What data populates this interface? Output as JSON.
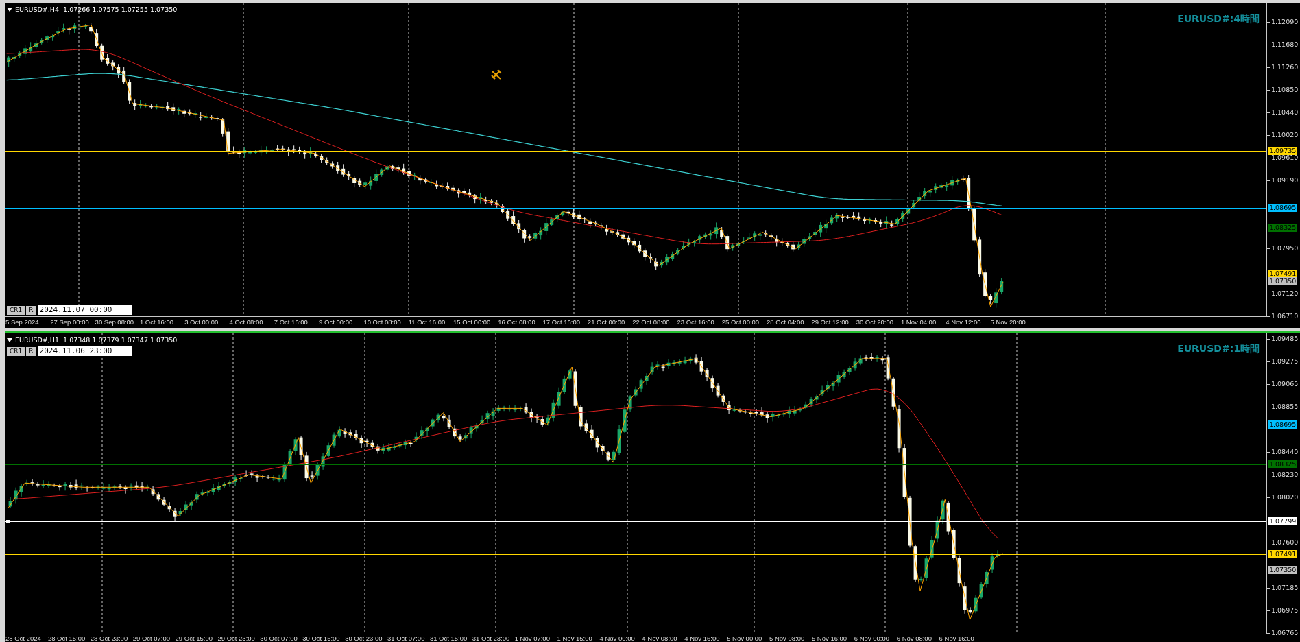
{
  "panels": [
    {
      "active": false,
      "header": "EURUSD#,H4  1.07266 1.07575 1.07255 1.07350",
      "title": "EURUSD#:4時間",
      "toolbar": {
        "buttons": [
          "CR1",
          "R"
        ],
        "date": "2024.11.07 00:00"
      },
      "price_ticks": [
        "1.12090",
        "1.11680",
        "1.11260",
        "1.10850",
        "1.10440",
        "1.10020",
        "1.09610",
        "1.09190",
        "1.07950",
        "1.07120",
        "1.06710"
      ],
      "price_levels": [
        {
          "price": "1.09735",
          "kind": "line",
          "color": "#ffd700"
        },
        {
          "price": "1.08695",
          "kind": "line",
          "color": "#00bfff"
        },
        {
          "price": "1.08325",
          "kind": "line",
          "color": "#007000"
        },
        {
          "price": "1.07491",
          "kind": "line",
          "color": "#ffd700"
        },
        {
          "price": "1.07350",
          "kind": "marker",
          "color": "#c0c0c0"
        }
      ],
      "time_labels": [
        "5 Sep 2024",
        "27 Sep 00:00",
        "30 Sep 08:00",
        "1 Oct 16:00",
        "3 Oct 00:00",
        "4 Oct 08:00",
        "7 Oct 16:00",
        "9 Oct 00:00",
        "10 Oct 08:00",
        "11 Oct 16:00",
        "15 Oct 00:00",
        "16 Oct 08:00",
        "17 Oct 16:00",
        "21 Oct 00:00",
        "22 Oct 08:00",
        "23 Oct 16:00",
        "25 Oct 00:00",
        "28 Oct 04:00",
        "29 Oct 12:00",
        "30 Oct 20:00",
        "1 Nov 04:00",
        "4 Nov 12:00",
        "5 Nov 20:00"
      ]
    },
    {
      "active": true,
      "header": "EURUSD#,H1  1.07348 1.07379 1.07347 1.07350",
      "title": "EURUSD#:1時間",
      "toolbar": {
        "buttons": [
          "CR1",
          "R"
        ],
        "date": "2024.11.06 23:00"
      },
      "price_ticks": [
        "1.09485",
        "1.09275",
        "1.09065",
        "1.08855",
        "1.08440",
        "1.08230",
        "1.08020",
        "1.07600",
        "1.07185",
        "1.06975",
        "1.06765"
      ],
      "price_levels": [
        {
          "price": "1.08695",
          "kind": "line",
          "color": "#00bfff"
        },
        {
          "price": "1.08325",
          "kind": "line",
          "color": "#007000"
        },
        {
          "price": "1.07799",
          "kind": "line",
          "color": "#ffffff"
        },
        {
          "price": "1.07491",
          "kind": "line",
          "color": "#ffd700"
        },
        {
          "price": "1.07350",
          "kind": "marker",
          "color": "#c0c0c0"
        }
      ],
      "time_labels": [
        "28 Oct 2024",
        "28 Oct 15:00",
        "28 Oct 23:00",
        "29 Oct 07:00",
        "29 Oct 15:00",
        "29 Oct 23:00",
        "30 Oct 07:00",
        "30 Oct 15:00",
        "30 Oct 23:00",
        "31 Oct 07:00",
        "31 Oct 15:00",
        "31 Oct 23:00",
        "1 Nov 07:00",
        "1 Nov 15:00",
        "4 Nov 00:00",
        "4 Nov 08:00",
        "4 Nov 16:00",
        "5 Nov 00:00",
        "5 Nov 08:00",
        "5 Nov 16:00",
        "6 Nov 00:00",
        "6 Nov 08:00",
        "6 Nov 16:00"
      ]
    }
  ]
}
